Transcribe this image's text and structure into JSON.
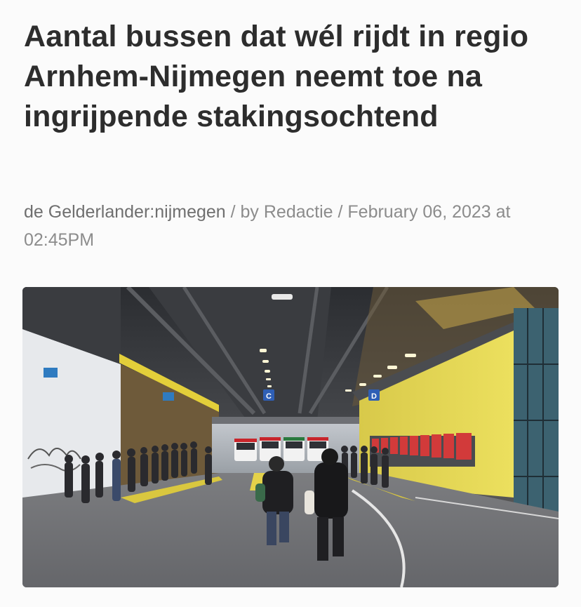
{
  "article": {
    "headline": "Aantal bussen dat wél rijdt in regio Arnhem-Nijmegen neemt toe na ingrijpende stakingsochtend",
    "meta": {
      "source": "de Gelderlander:nijmegen",
      "separator": " / ",
      "author": "by Redactie",
      "date": "February 06, 2023 at 02:45PM"
    },
    "image": {
      "platform_signs": [
        "C",
        "D"
      ]
    }
  }
}
